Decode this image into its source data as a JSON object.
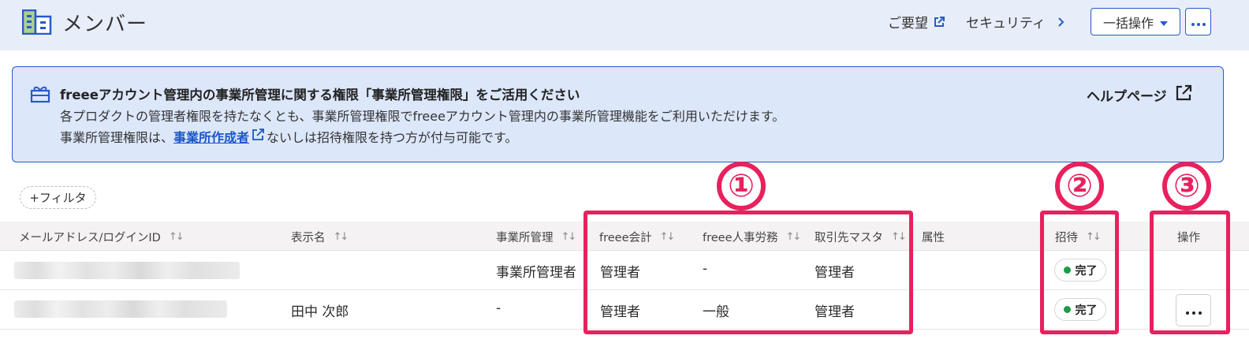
{
  "header": {
    "title": "メンバー",
    "request_link": "ご要望",
    "security_link": "セキュリティ",
    "bulk_button": "一括操作"
  },
  "banner": {
    "title": "freeeアカウント管理内の事業所管理に関する権限「事業所管理権限」をご活用ください",
    "line1": "各プロダクトの管理者権限を持たなくとも、事業所管理権限でfreeeアカウント管理内の事業所管理機能をご利用いただけます。",
    "line2_prefix": "事業所管理権限は、",
    "line2_link": "事業所作成者",
    "line2_suffix": "ないしは招待権限を持つ方が付与可能です。",
    "help_link": "ヘルプページ"
  },
  "filter": {
    "label": "+フィルタ"
  },
  "table": {
    "columns": [
      "メールアドレス/ログインID",
      "表示名",
      "事業所管理",
      "freee会計",
      "freee人事労務",
      "取引先マスタ",
      "属性",
      "招待",
      "操作"
    ],
    "rows": [
      {
        "display_name": "",
        "office_admin": "事業所管理者",
        "accounting": "管理者",
        "hr": "-",
        "partner_master": "管理者",
        "attribute": "",
        "invite": "完了"
      },
      {
        "display_name": "田中 次郎",
        "office_admin": "-",
        "accounting": "管理者",
        "hr": "一般",
        "partner_master": "管理者",
        "attribute": "",
        "invite": "完了"
      }
    ]
  },
  "annotations": {
    "labels": [
      "①",
      "②",
      "③"
    ],
    "color": "#e8215e"
  },
  "colors": {
    "accent": "#285ac8",
    "header_bg": "#e8eef9",
    "banner_bg": "#dce7fa",
    "status_complete": "#1e9b46"
  }
}
